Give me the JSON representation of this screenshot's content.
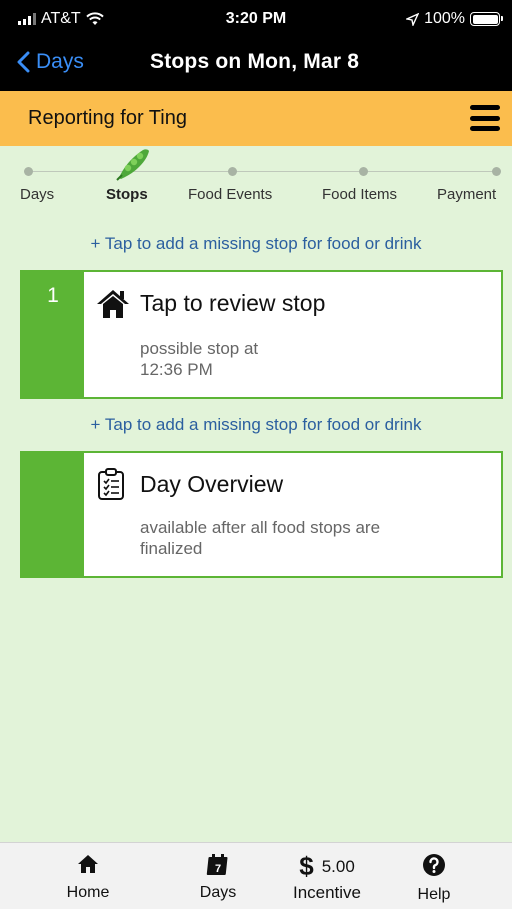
{
  "status_bar": {
    "carrier": "AT&T",
    "time": "3:20 PM",
    "battery": "100%"
  },
  "nav": {
    "back_label": "Days",
    "title": "Stops on Mon, Mar 8"
  },
  "report_bar": {
    "text": "Reporting for Ting"
  },
  "steps": [
    {
      "label": "Days"
    },
    {
      "label": "Stops"
    },
    {
      "label": "Food Events"
    },
    {
      "label": "Food Items"
    },
    {
      "label": "Payment"
    }
  ],
  "add_stop_link": "+ Tap to add a missing stop for food or drink",
  "cards": [
    {
      "number": "1",
      "title": "Tap to review stop",
      "subtitle": "possible stop at\n12:36 PM",
      "icon": "house-icon"
    },
    {
      "number": "",
      "title": "Day Overview",
      "subtitle": "available after all food stops are finalized",
      "icon": "clipboard-icon"
    }
  ],
  "tab_bar": {
    "home": "Home",
    "days": "Days",
    "days_calendar_number": "7",
    "incentive_amount": "5.00",
    "incentive_label": "Incentive",
    "help": "Help"
  },
  "colors": {
    "accent_green": "#5cb535",
    "background": "#e2f3d9",
    "report_bar": "#fbbd4d",
    "link_blue": "#2b5f9f",
    "nav_back_blue": "#3a8ef6"
  }
}
